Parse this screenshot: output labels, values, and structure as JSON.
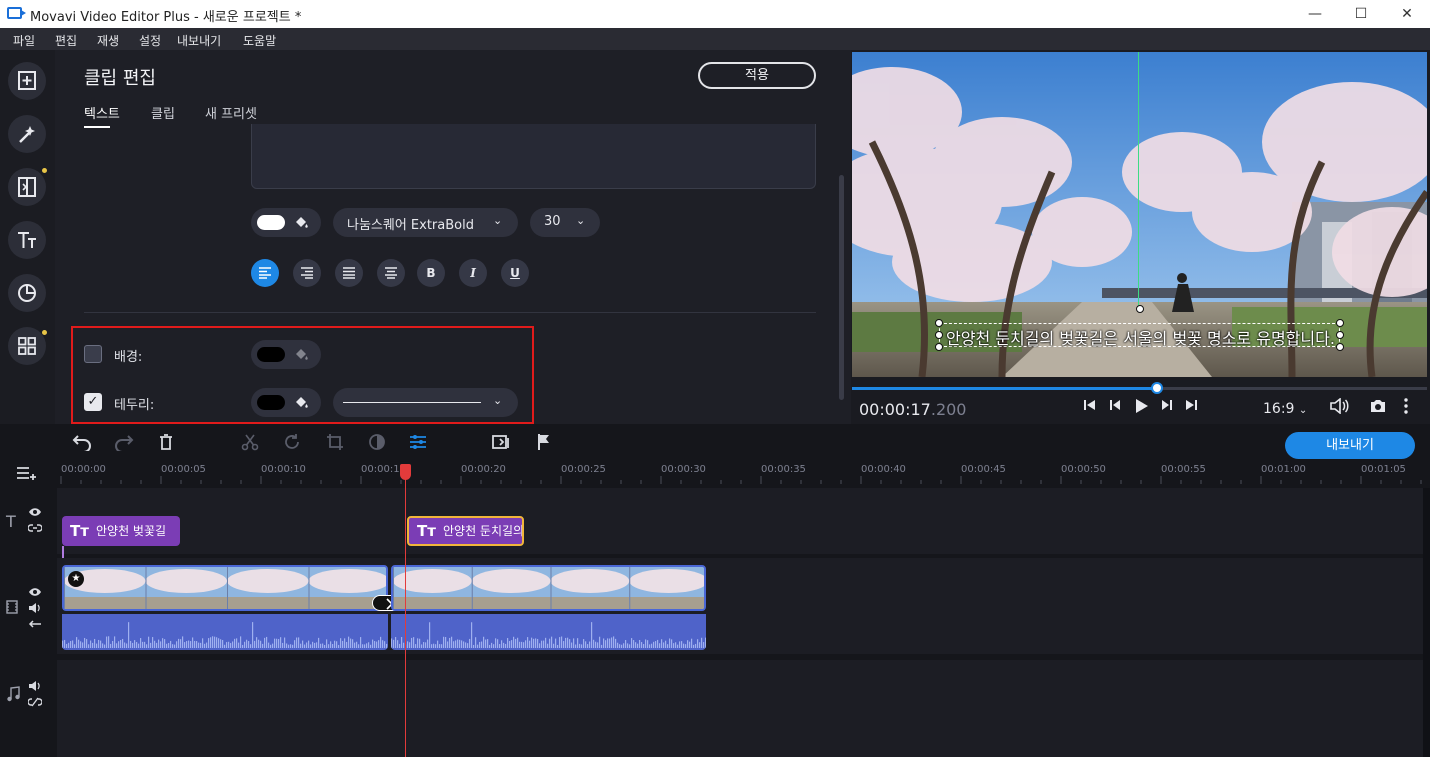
{
  "window": {
    "title": "Movavi Video Editor Plus - 새로운 프로젝트 *",
    "minimize": "—",
    "maximize": "☐",
    "close": "✕"
  },
  "menu": [
    "파일",
    "편집",
    "재생",
    "설정",
    "내보내기",
    "도움말"
  ],
  "rail": {
    "icons": [
      "import-icon",
      "effects-icon",
      "transitions-icon",
      "titles-icon",
      "stickers-icon",
      "more-tools-icon"
    ]
  },
  "panel": {
    "title": "클립 편집",
    "apply_label": "적용",
    "tabs": [
      "텍스트",
      "클립",
      "새 프리셋"
    ],
    "active_tab": "텍스트",
    "font_name": "나눔스퀘어 ExtraBold",
    "font_size": "30",
    "format_buttons": [
      "align-left-icon",
      "align-right-icon",
      "justify-icon",
      "align-center-icon",
      "bold-icon",
      "italic-icon",
      "underline-icon"
    ],
    "format_glyphs": [
      "B",
      "I",
      "U"
    ],
    "background": {
      "label": "배경:",
      "checked": false,
      "color": "#000000"
    },
    "border": {
      "label": "테두리:",
      "checked": true,
      "color": "#000000",
      "line_style": "solid"
    }
  },
  "preview": {
    "caption": "안양천 둔치길의 벚꽃길은 서울의 벚꽃 명소로 유명합니다.",
    "time_main": "00:00:17",
    "time_ms": ".200",
    "aspect": "16:9",
    "progress": 0.53
  },
  "timeline": {
    "export_label": "내보내기",
    "ticks": [
      "00:00:00",
      "00:00:05",
      "00:00:10",
      "00:00:15",
      "00:00:20",
      "00:00:25",
      "00:00:30",
      "00:00:35",
      "00:00:40",
      "00:00:45",
      "00:00:50",
      "00:00:55",
      "00:01:00",
      "00:01:05"
    ],
    "title_clips": [
      {
        "label": "안양천 벚꽃길"
      },
      {
        "label": "안양천 둔치길의"
      }
    ]
  },
  "colors": {
    "accent": "#1e88e5",
    "highlight_box": "#e01b1b",
    "title_clip": "#7b3db5",
    "audio_wave": "#4f63c9",
    "playhead": "#e23b3b"
  }
}
